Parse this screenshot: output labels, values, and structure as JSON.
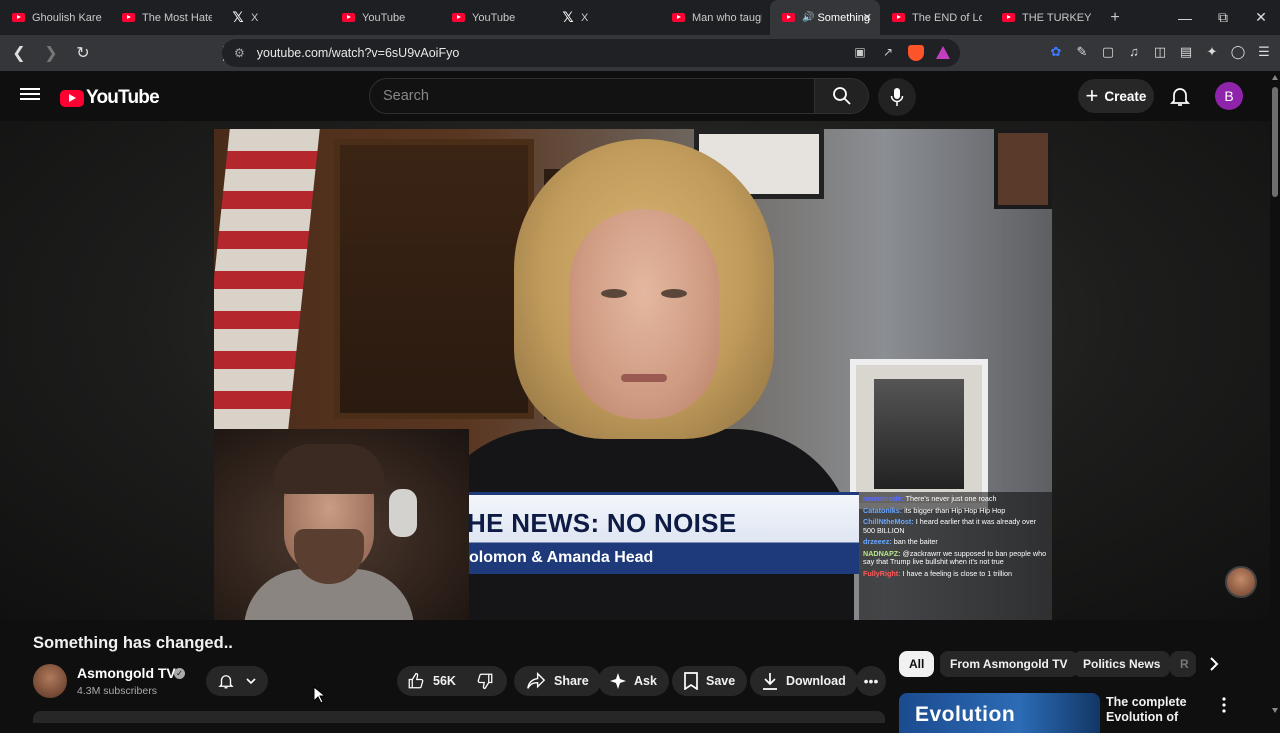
{
  "browser": {
    "tabs": [
      {
        "title": "Ghoulish Karen",
        "icon": "youtube-icon"
      },
      {
        "title": "The Most Hated",
        "icon": "youtube-icon"
      },
      {
        "title": "X",
        "icon": "x-icon"
      },
      {
        "title": "YouTube",
        "icon": "youtube-icon"
      },
      {
        "title": "YouTube",
        "icon": "youtube-icon"
      },
      {
        "title": "X",
        "icon": "x-icon"
      },
      {
        "title": "Man who taught",
        "icon": "youtube-icon"
      },
      {
        "title": "Something",
        "icon": "youtube-icon",
        "active": true,
        "audio": true
      },
      {
        "title": "The END of Lol",
        "icon": "youtube-icon"
      },
      {
        "title": "THE TURKEY TO",
        "icon": "youtube-icon"
      }
    ],
    "new_tab": "+",
    "url": "youtube.com/watch?v=6sU9vAoiFyo"
  },
  "youtube": {
    "logo_text": "YouTube",
    "search_placeholder": "Search",
    "create_label": "Create",
    "account_initial": "B"
  },
  "video": {
    "lower_third_title": "HE NEWS: NO NOISE",
    "lower_third_sub": "olomon & Amanda Head",
    "chat": [
      {
        "user": "ravenmode:",
        "msg": "There's never just one roach",
        "color": "#5b6bff"
      },
      {
        "user": "Catatoniks:",
        "msg": "its bigger than Hip Hop Hip Hop",
        "color": "#6aa7ff"
      },
      {
        "user": "ChillNtheMost:",
        "msg": "I heard earlier that it was already over 500 BILLION",
        "color": "#6aa7ff"
      },
      {
        "user": "drzeeez:",
        "msg": "ban the baiter",
        "color": "#6aa7ff"
      },
      {
        "user": "NADNAPZ:",
        "msg": "@zackrawrr we supposed to ban people who say that Trump live bullshit when it's not true",
        "color": "#b8e986"
      },
      {
        "user": "FullyRight:",
        "msg": "I have a feeling is close to 1 trillion",
        "color": "#ff5a5a"
      }
    ]
  },
  "watch": {
    "title": "Something has changed..",
    "channel_name": "Asmongold TV",
    "subscribers": "4.3M subscribers",
    "likes": "56K",
    "share_label": "Share",
    "ask_label": "Ask",
    "save_label": "Save",
    "download_label": "Download"
  },
  "related": {
    "chips": [
      "All",
      "From Asmongold TV",
      "Politics News",
      "R"
    ],
    "first_title": "The complete Evolution of Halo's",
    "first_thumb_text": "Evolution"
  },
  "colors": {
    "accent": "#ff0033",
    "background": "#0f0f0f",
    "pill": "#272727",
    "avatar": "#8e24aa"
  }
}
